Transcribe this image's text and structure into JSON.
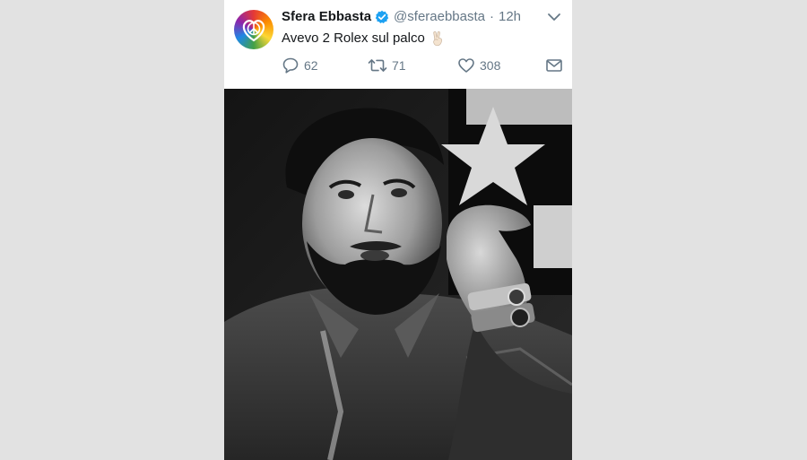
{
  "tweet": {
    "author_name": "Sfera Ebbasta",
    "handle": "@sferaebbasta",
    "separator": "·",
    "time": "12h",
    "text": "Avevo 2 Rolex sul palco",
    "emoji": "victory-hand",
    "actions": {
      "reply_count": "62",
      "retweet_count": "71",
      "like_count": "308"
    },
    "icons": [
      "avatar-peace-heart",
      "verified-badge-icon",
      "chevron-down-icon",
      "reply-icon",
      "retweet-icon",
      "like-icon",
      "mail-icon"
    ]
  },
  "colors": {
    "background": "#e2e2e2",
    "card": "#ffffff",
    "verified": "#1da1f2",
    "muted": "#657786",
    "text": "#14171a"
  }
}
